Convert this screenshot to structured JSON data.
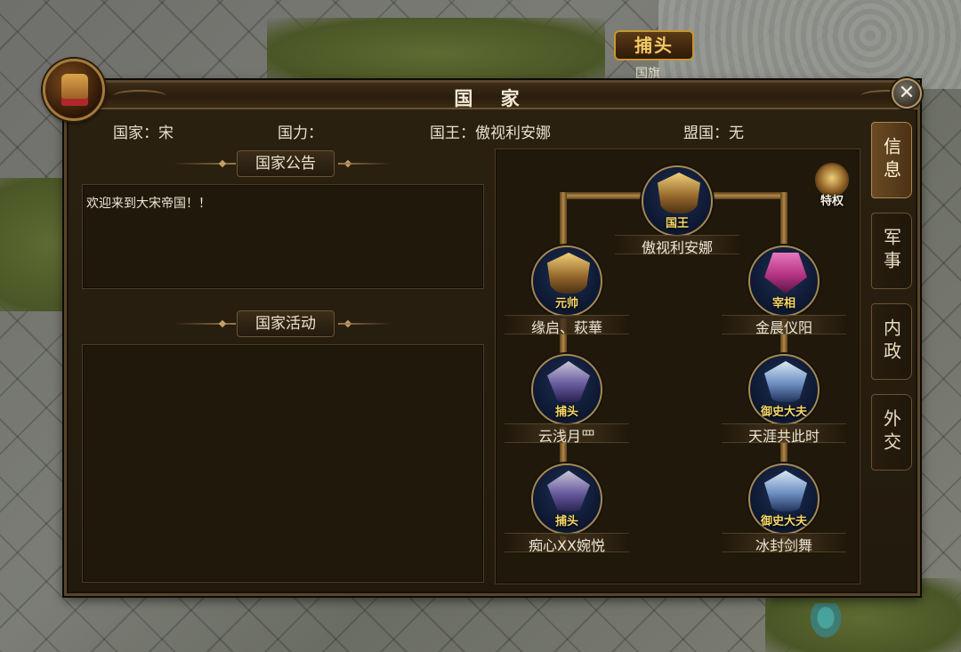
{
  "game_sign": {
    "label": "捕头",
    "sub": "国旗"
  },
  "window": {
    "title": "国 家",
    "close_label": "✕"
  },
  "info": {
    "country_label": "国家：",
    "country_value": "宋",
    "power_label": "国力：",
    "power_value": "",
    "king_label": "国王：",
    "king_value": "傲视利安娜",
    "ally_label": "盟国：",
    "ally_value": "无"
  },
  "announcement": {
    "header": "国家公告",
    "text": "欢迎来到大宋帝国！！"
  },
  "activity": {
    "header": "国家活动",
    "text": ""
  },
  "privilege": {
    "label": "特权",
    "icon": "privilege-icon"
  },
  "hierarchy": {
    "king": {
      "title": "国王",
      "name": "傲视利安娜"
    },
    "marshal": {
      "title": "元帅",
      "name": "缘启、萩華"
    },
    "chancellor": {
      "title": "宰相",
      "name": "金晨仪阳"
    },
    "constable_1": {
      "title": "捕头",
      "name": "云浅月罒"
    },
    "constable_2": {
      "title": "捕头",
      "name": "痴心XX婉悦"
    },
    "censor_1": {
      "title": "御史大夫",
      "name": "天涯共此时"
    },
    "censor_2": {
      "title": "御史大夫",
      "name": "冰封剑舞"
    }
  },
  "tabs": [
    {
      "label": "信息",
      "active": true
    },
    {
      "label": "军事",
      "active": false
    },
    {
      "label": "内政",
      "active": false
    },
    {
      "label": "外交",
      "active": false
    }
  ],
  "colors": {
    "accent_gold": "#b48843",
    "panel_bg": "#221a0d",
    "text": "#ede6d3",
    "title_gold": "#f6d76a"
  }
}
